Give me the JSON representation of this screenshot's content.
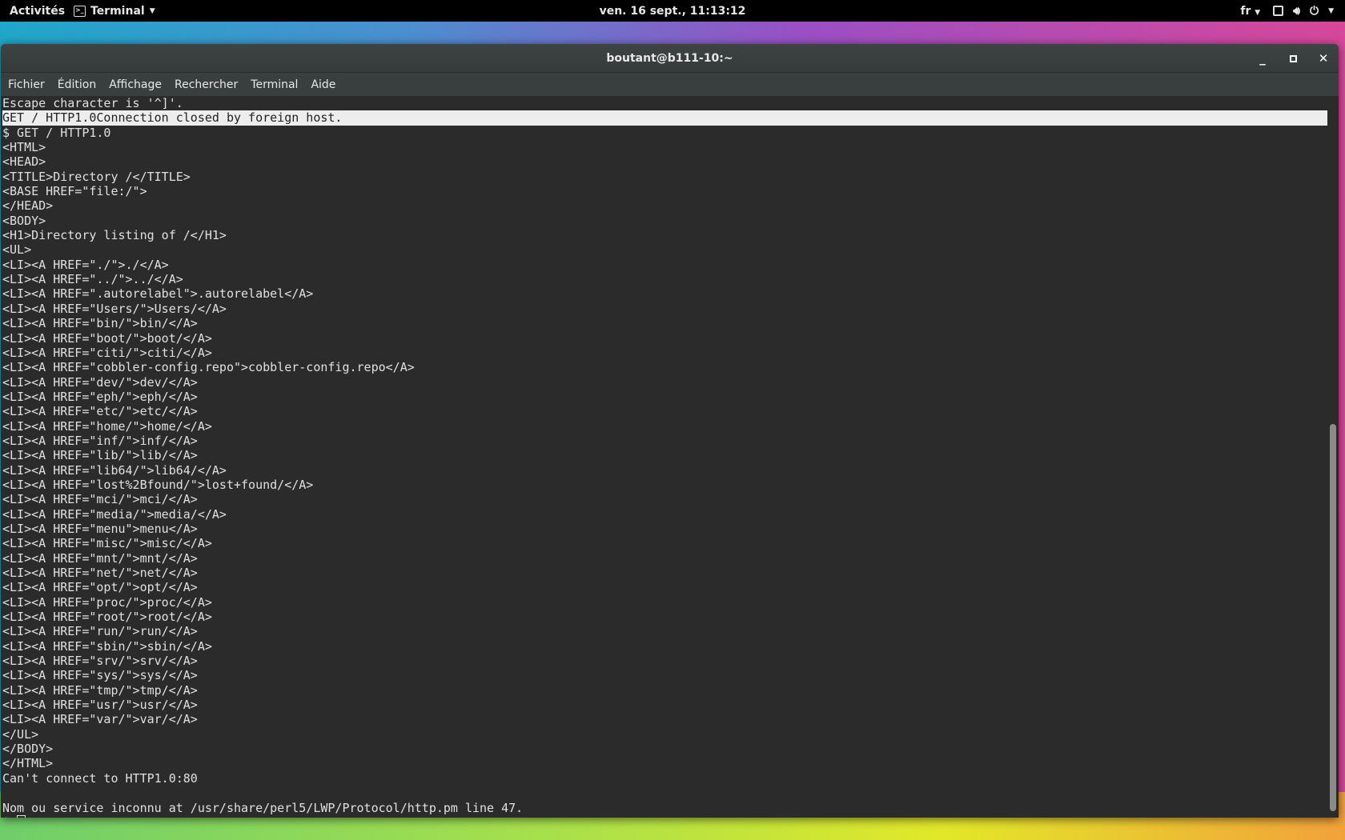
{
  "topbar": {
    "activities": "Activités",
    "app_name": "Terminal",
    "clock": "ven. 16 sept., 11:13:12",
    "keyboard_layout": "fr",
    "icons": [
      "terminal-icon",
      "window-icon",
      "volume-icon",
      "power-icon"
    ]
  },
  "window": {
    "title": "boutant@b111-10:~",
    "controls": {
      "minimize": "_",
      "maximize": "▫",
      "close": "✕"
    }
  },
  "menu": [
    "Fichier",
    "Édition",
    "Affichage",
    "Rechercher",
    "Terminal",
    "Aide"
  ],
  "terminal": {
    "selected_line": 1,
    "lines": [
      "Escape character is '^]'.",
      "GET / HTTP1.0Connection closed by foreign host.",
      "$ GET / HTTP1.0",
      "<HTML>",
      "<HEAD>",
      "<TITLE>Directory /</TITLE>",
      "<BASE HREF=\"file:/\">",
      "</HEAD>",
      "<BODY>",
      "<H1>Directory listing of /</H1>",
      "<UL>",
      "<LI><A HREF=\"./\">./</A>",
      "<LI><A HREF=\"../\">../</A>",
      "<LI><A HREF=\".autorelabel\">.autorelabel</A>",
      "<LI><A HREF=\"Users/\">Users/</A>",
      "<LI><A HREF=\"bin/\">bin/</A>",
      "<LI><A HREF=\"boot/\">boot/</A>",
      "<LI><A HREF=\"citi/\">citi/</A>",
      "<LI><A HREF=\"cobbler-config.repo\">cobbler-config.repo</A>",
      "<LI><A HREF=\"dev/\">dev/</A>",
      "<LI><A HREF=\"eph/\">eph/</A>",
      "<LI><A HREF=\"etc/\">etc/</A>",
      "<LI><A HREF=\"home/\">home/</A>",
      "<LI><A HREF=\"inf/\">inf/</A>",
      "<LI><A HREF=\"lib/\">lib/</A>",
      "<LI><A HREF=\"lib64/\">lib64/</A>",
      "<LI><A HREF=\"lost%2Bfound/\">lost+found/</A>",
      "<LI><A HREF=\"mci/\">mci/</A>",
      "<LI><A HREF=\"media/\">media/</A>",
      "<LI><A HREF=\"menu\">menu</A>",
      "<LI><A HREF=\"misc/\">misc/</A>",
      "<LI><A HREF=\"mnt/\">mnt/</A>",
      "<LI><A HREF=\"net/\">net/</A>",
      "<LI><A HREF=\"opt/\">opt/</A>",
      "<LI><A HREF=\"proc/\">proc/</A>",
      "<LI><A HREF=\"root/\">root/</A>",
      "<LI><A HREF=\"run/\">run/</A>",
      "<LI><A HREF=\"sbin/\">sbin/</A>",
      "<LI><A HREF=\"srv/\">srv/</A>",
      "<LI><A HREF=\"sys/\">sys/</A>",
      "<LI><A HREF=\"tmp/\">tmp/</A>",
      "<LI><A HREF=\"usr/\">usr/</A>",
      "<LI><A HREF=\"var/\">var/</A>",
      "</UL>",
      "</BODY>",
      "</HTML>",
      "Can't connect to HTTP1.0:80",
      "",
      "Nom ou service inconnu at /usr/share/perl5/LWP/Protocol/http.pm line 47."
    ],
    "prompt": "$ "
  }
}
